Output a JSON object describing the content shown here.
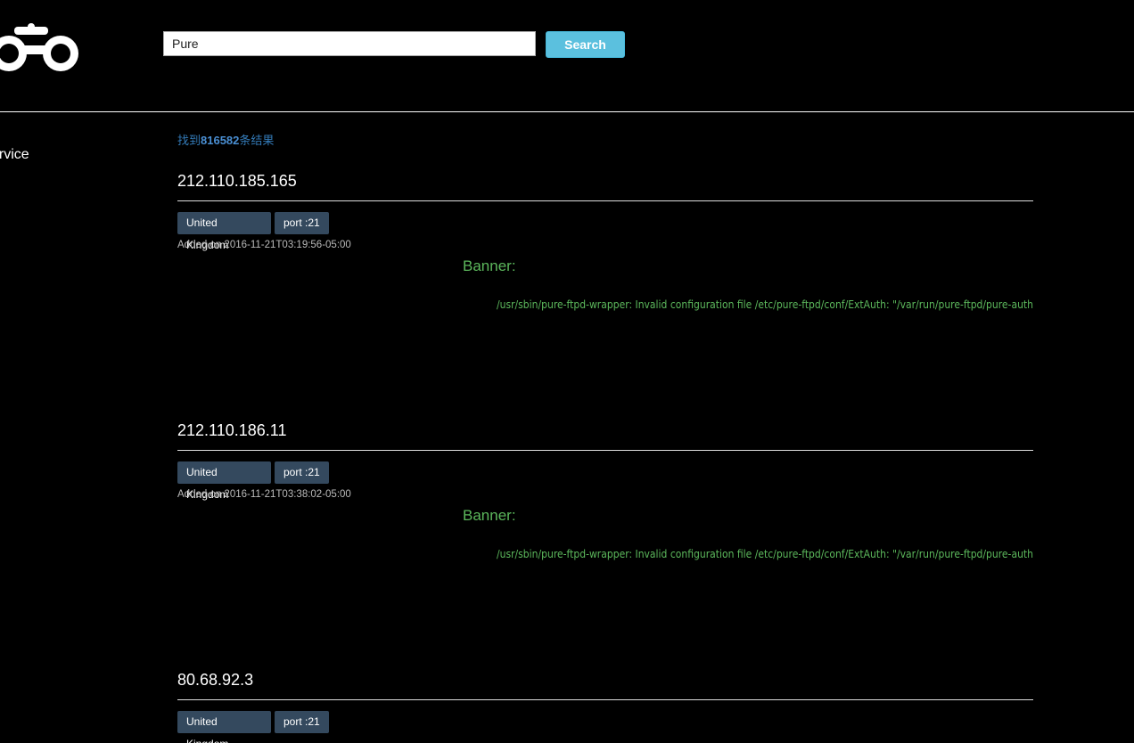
{
  "header": {
    "logo_icon": "binoculars-icon",
    "search": {
      "value": "Pure",
      "button_label": "Search"
    }
  },
  "sidebar": {
    "link_label": "ervice"
  },
  "summary": {
    "prefix": "找到",
    "count": "816582",
    "suffix": "条结果"
  },
  "results": [
    {
      "ip": "212.110.185.165",
      "country": "United Kingdom",
      "port": "port :21",
      "added": "Added on 2016-11-21T03:19:56-05:00",
      "banner_label": "Banner:",
      "banner": "/usr/sbin/pure-ftpd-wrapper: Invalid configuration file /etc/pure-ftpd/conf/ExtAuth: \"/var/run/pure-ftpd/pure-auth"
    },
    {
      "ip": "212.110.186.11",
      "country": "United Kingdom",
      "port": "port :21",
      "added": "Added on 2016-11-21T03:38:02-05:00",
      "banner_label": "Banner:",
      "banner": "/usr/sbin/pure-ftpd-wrapper: Invalid configuration file /etc/pure-ftpd/conf/ExtAuth: \"/var/run/pure-ftpd/pure-auth"
    },
    {
      "ip": "80.68.92.3",
      "country": "United Kingdom",
      "port": "port :21",
      "added": "",
      "banner_label": "",
      "banner": ""
    }
  ]
}
